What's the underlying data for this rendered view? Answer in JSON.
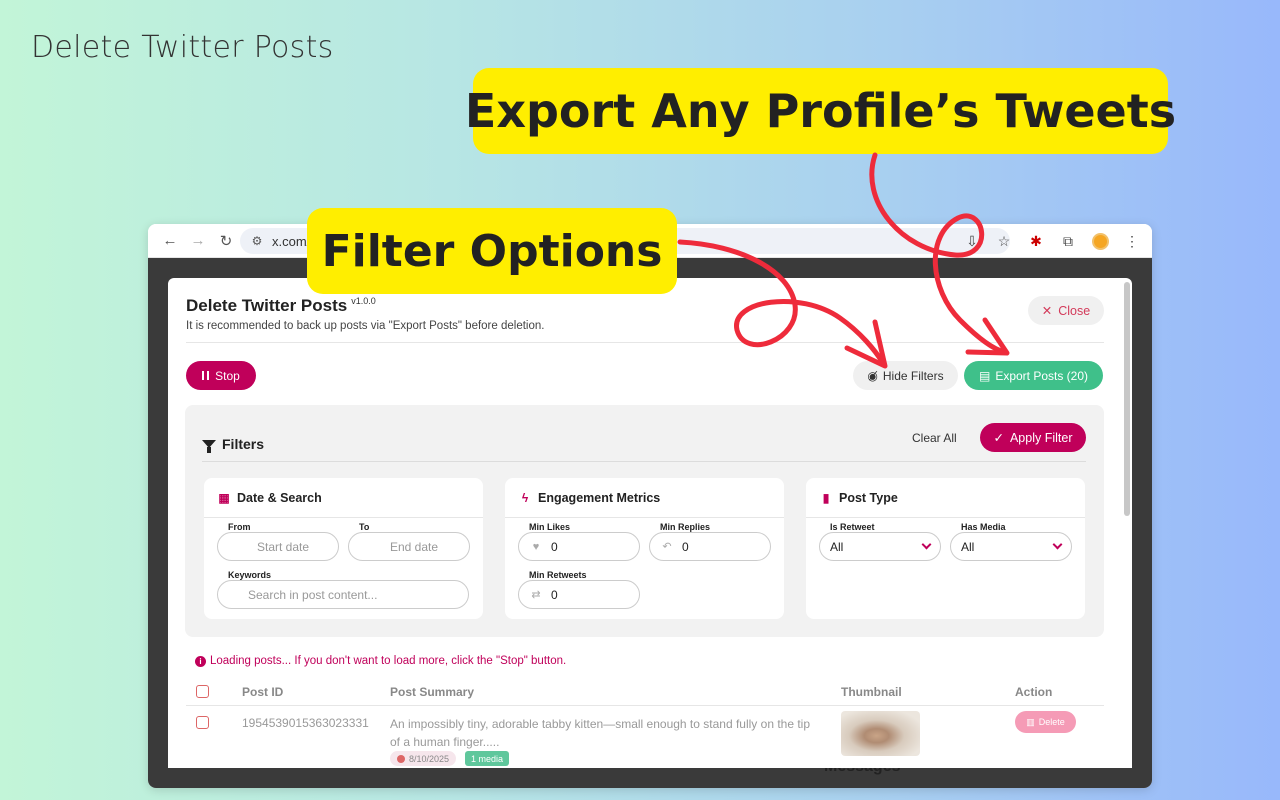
{
  "page_heading": "Delete Twitter Posts",
  "callouts": {
    "export": "Export Any Profile’s Tweets",
    "filter": "Filter Options"
  },
  "browser": {
    "url": "x.com/"
  },
  "background_page": {
    "messages_label": "Messages"
  },
  "modal": {
    "title": "Delete Twitter Posts",
    "version": "v1.0.0",
    "subtitle": "It is recommended to back up posts via \"Export Posts\" before deletion.",
    "close_label": "Close",
    "stop_label": "Stop",
    "hide_filters_label": "Hide Filters",
    "export_label": "Export Posts (20)",
    "filters": {
      "title": "Filters",
      "clear_all": "Clear All",
      "apply": "Apply Filter",
      "date_search": {
        "title": "Date & Search",
        "from_label": "From",
        "from_placeholder": "Start date",
        "to_label": "To",
        "to_placeholder": "End date",
        "keywords_label": "Keywords",
        "keywords_placeholder": "Search in post content..."
      },
      "engagement": {
        "title": "Engagement Metrics",
        "min_likes_label": "Min Likes",
        "min_likes_value": "0",
        "min_replies_label": "Min Replies",
        "min_replies_value": "0",
        "min_retweets_label": "Min Retweets",
        "min_retweets_value": "0"
      },
      "post_type": {
        "title": "Post Type",
        "is_retweet_label": "Is Retweet",
        "is_retweet_value": "All",
        "has_media_label": "Has Media",
        "has_media_value": "All"
      }
    },
    "loading_message": "Loading posts... If you don't want to load more, click the \"Stop\" button.",
    "table": {
      "headers": [
        "Post ID",
        "Post Summary",
        "Thumbnail",
        "Action"
      ],
      "rows": [
        {
          "post_id": "1954539015363023331",
          "summary": "An impossibly tiny, adorable tabby kitten—small enough to stand fully on the tip of a human finger.....",
          "date": "8/10/2025",
          "media": "1 media",
          "action": "Delete"
        }
      ]
    }
  },
  "colors": {
    "brand": "#c0005a",
    "export_green": "#3fc08a",
    "callout_yellow": "#ffee00",
    "arrow_red": "#ee2b3b"
  }
}
